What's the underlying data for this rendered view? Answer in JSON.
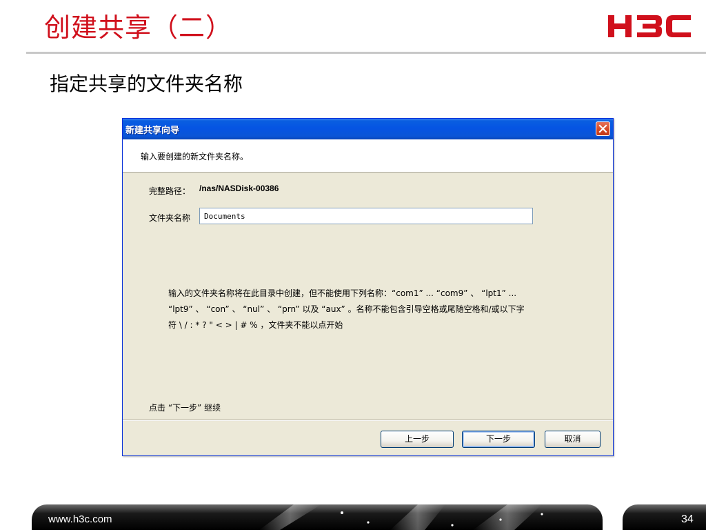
{
  "slide": {
    "title": "创建共享（二）",
    "logo_text": "H3C",
    "subtitle": "指定共享的文件夹名称",
    "footer_url": "www.h3c.com",
    "page_number": "34"
  },
  "dialog": {
    "title": "新建共享向导",
    "prompt": "输入要创建的新文件夹名称。",
    "full_path_label": "完整路径：",
    "full_path_value": "/nas/NASDisk-00386",
    "folder_name_label": "文件夹名称",
    "folder_name_value": "Documents",
    "info_line1": "输入的文件夹名称将在此目录中创建，但不能使用下列名称：“com1” ... “com9” 、 “lpt1” ...",
    "info_line2": "“lpt9” 、 “con” 、 “nul” 、 “prn” 以及 “aux” 。名称不能包含引导空格或尾随空格和/或以下字",
    "info_line3": "符 \\ / : * ? \" < > | # % ，文件夹不能以点开始",
    "continue_hint": "点击 “下一步” 继续",
    "buttons": {
      "back": "上一步",
      "next": "下一步",
      "cancel": "取消"
    }
  },
  "colors": {
    "title_red": "#d0101c",
    "titlebar_blue": "#0554e3",
    "dialog_bg": "#ece9d8",
    "close_red": "#d34520"
  }
}
